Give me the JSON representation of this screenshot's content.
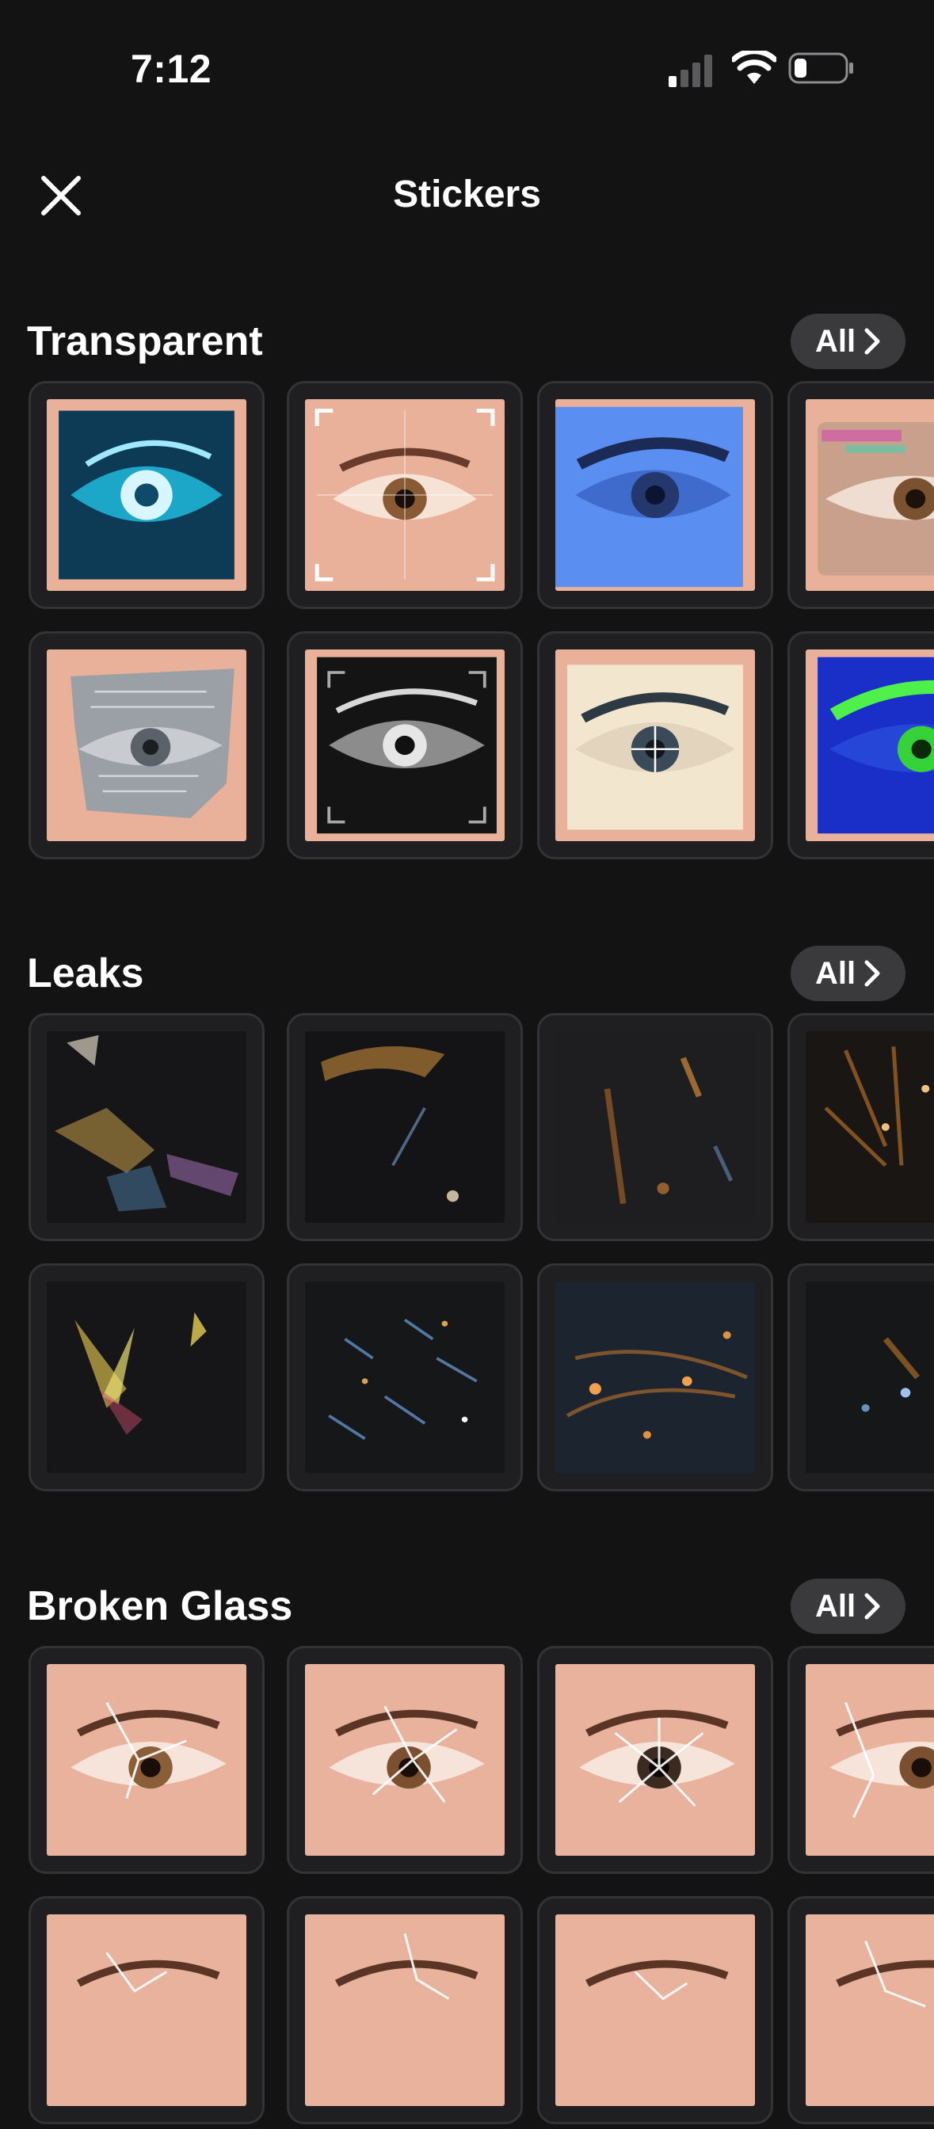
{
  "status_bar": {
    "time": "7:12"
  },
  "nav": {
    "title": "Stickers"
  },
  "sections": [
    {
      "title": "Transparent",
      "all_label": "All",
      "tiles": [
        {
          "variant": "cyan-eye"
        },
        {
          "variant": "frame-eye"
        },
        {
          "variant": "blue-eye"
        },
        {
          "variant": "glitch-eye"
        },
        {
          "variant": "paper-eye"
        },
        {
          "variant": "mono-eye"
        },
        {
          "variant": "cream-eye"
        },
        {
          "variant": "green-eye"
        }
      ]
    },
    {
      "title": "Leaks",
      "all_label": "All",
      "tiles": [
        {
          "variant": "prism-leak"
        },
        {
          "variant": "amber-streak"
        },
        {
          "variant": "bokeh-streak"
        },
        {
          "variant": "orange-rays"
        },
        {
          "variant": "rainbow-flare"
        },
        {
          "variant": "blue-particles"
        },
        {
          "variant": "warm-particles"
        },
        {
          "variant": "dim-flare"
        }
      ]
    },
    {
      "title": "Broken Glass",
      "all_label": "All",
      "tiles": [
        {
          "variant": "crack-1"
        },
        {
          "variant": "crack-2"
        },
        {
          "variant": "crack-3"
        },
        {
          "variant": "crack-4"
        },
        {
          "variant": "crack-5"
        },
        {
          "variant": "crack-6"
        },
        {
          "variant": "crack-7"
        },
        {
          "variant": "crack-8"
        }
      ]
    }
  ],
  "colors": {
    "background": "#131314",
    "tile": "#1f1f21",
    "tile_border": "#333335",
    "pill": "#3a3a3c",
    "skin": "#eab19a"
  }
}
